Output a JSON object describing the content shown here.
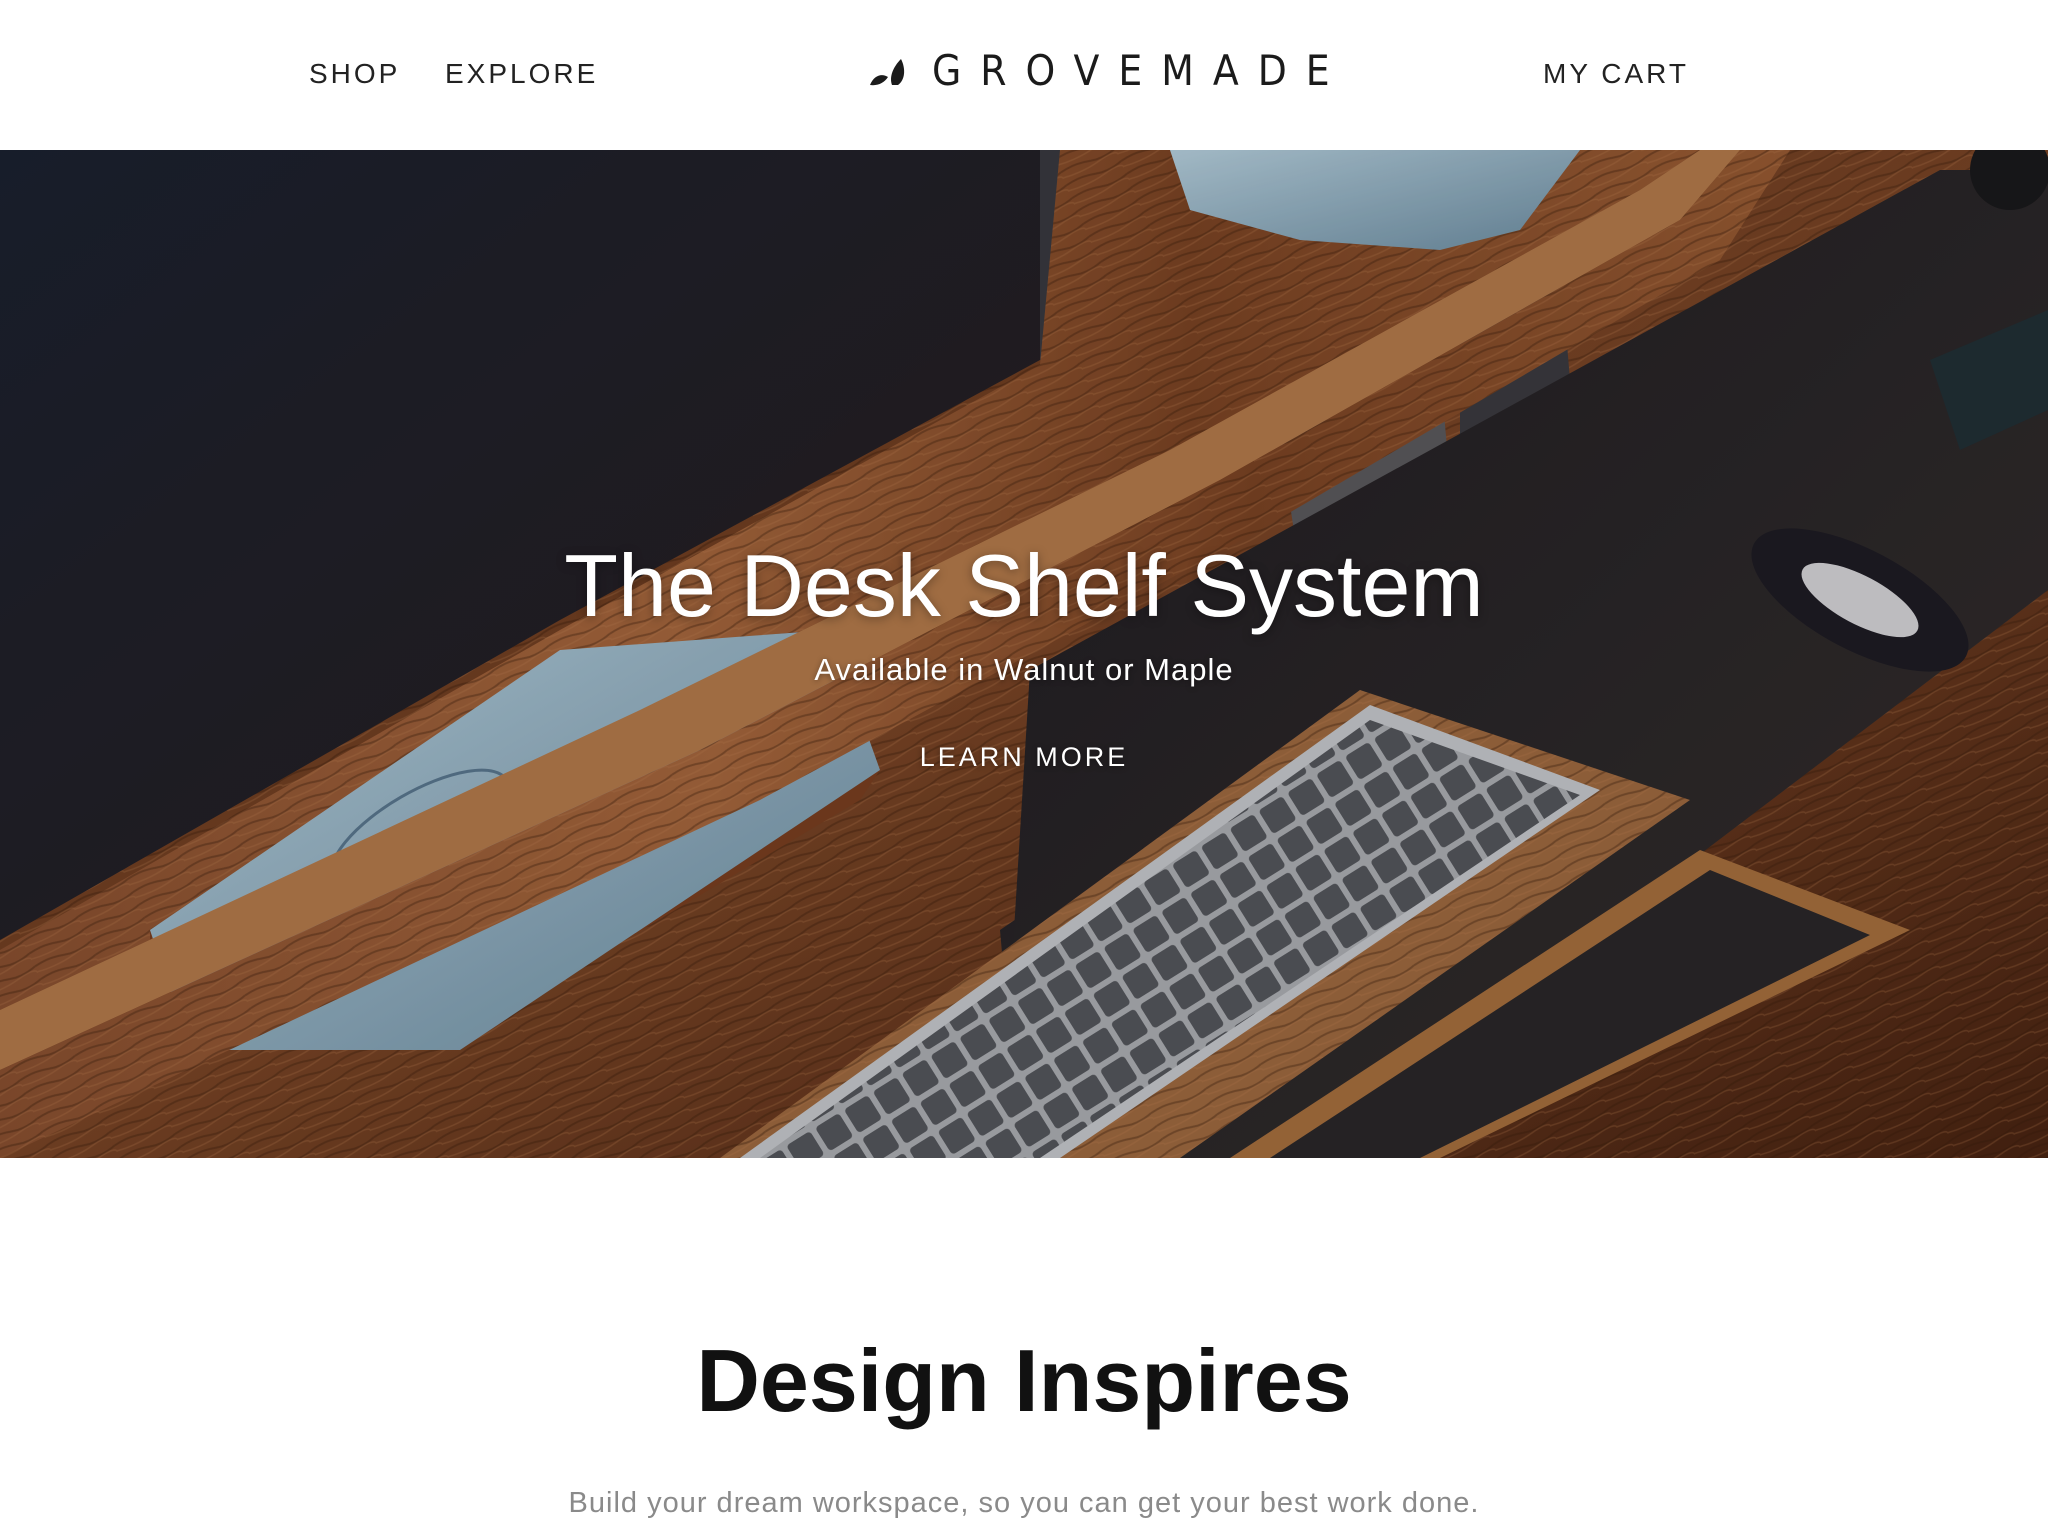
{
  "header": {
    "nav": [
      {
        "label": "SHOP"
      },
      {
        "label": "EXPLORE"
      }
    ],
    "logo_text": "GROVEMADE",
    "cart_label": "MY CART"
  },
  "hero": {
    "title": "The Desk Shelf System",
    "subtitle": "Available in Walnut or Maple",
    "cta_label": "LEARN MORE"
  },
  "intro": {
    "title": "Design Inspires",
    "text": "Build your dream workspace, so you can get your best work done."
  },
  "colors": {
    "text_dark": "#222222",
    "text_muted": "#8a8a8a",
    "walnut": "#6b3a1e",
    "desk_pad": "#2a2628"
  }
}
